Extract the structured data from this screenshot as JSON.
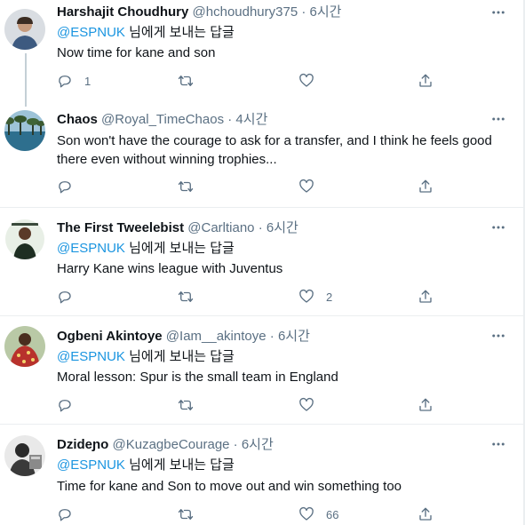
{
  "tweets": [
    {
      "name": "Harshajit Choudhury",
      "handle": "@hchoudhury375",
      "dot": "·",
      "time": "6시간",
      "reply_mention": "@ESPNUK",
      "reply_suffix": " 님에게 보내는 답글",
      "text": "Now time for kane and son",
      "reply_count": "1",
      "retweet_count": "",
      "like_count": ""
    },
    {
      "name": "Chaos",
      "handle": "@Royal_TimeChaos",
      "dot": "·",
      "time": "4시간",
      "text": "Son won't have the courage to ask for a transfer, and I think he feels good there even without winning trophies...",
      "reply_count": "",
      "retweet_count": "",
      "like_count": ""
    },
    {
      "name": "The First Tweelebist",
      "handle": "@Carltiano",
      "dot": "·",
      "time": "6시간",
      "reply_mention": "@ESPNUK",
      "reply_suffix": " 님에게 보내는 답글",
      "text": "Harry Kane wins league with Juventus",
      "reply_count": "",
      "retweet_count": "",
      "like_count": "2"
    },
    {
      "name": "Ogbeni Akintoye",
      "handle": "@Iam__akintoye",
      "dot": "·",
      "time": "6시간",
      "reply_mention": "@ESPNUK",
      "reply_suffix": " 님에게 보내는 답글",
      "text": "Moral lesson: Spur is the small team in England",
      "reply_count": "",
      "retweet_count": "",
      "like_count": ""
    },
    {
      "name": "Dzideɲo",
      "handle": "@KuzagbeCourage",
      "dot": "·",
      "time": "6시간",
      "reply_mention": "@ESPNUK",
      "reply_suffix": " 님에게 보내는 답글",
      "text": "Time for kane and Son to move out and win something too",
      "reply_count": "",
      "retweet_count": "",
      "like_count": "66"
    }
  ],
  "colors": {
    "accent": "#1b95e0",
    "secondary_text": "#5b7083",
    "icon": "#5b7083",
    "divider": "#ebeef0",
    "thread_line": "#c4cfd6"
  },
  "icons": [
    "more-icon",
    "reply-icon",
    "retweet-icon",
    "like-icon",
    "share-icon"
  ]
}
